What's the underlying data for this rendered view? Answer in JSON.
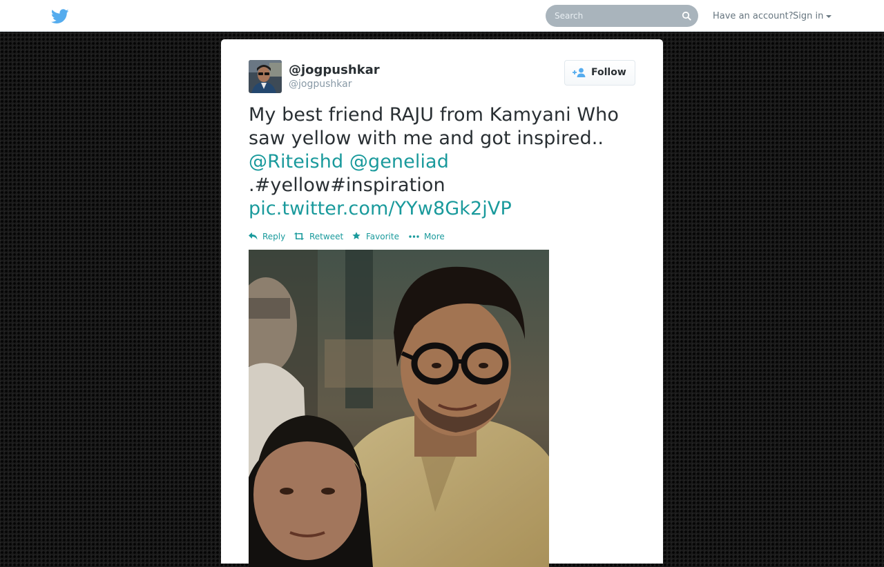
{
  "topbar": {
    "search_placeholder": "Search",
    "have_account": "Have an account?",
    "sign_in": "Sign in"
  },
  "tweet": {
    "fullname": "@jogpushkar",
    "screenname": "@jogpushkar",
    "follow_label": "Follow",
    "text_line1": "My best friend RAJU from Kamyani Who",
    "text_line2": "saw yellow with me and got inspired..",
    "mention1": "@Riteishd",
    "mention2": "@geneliad",
    "text_line4": ".#yellow#inspiration",
    "pic_link": "pic.twitter.com/YYw8Gk2jVP"
  },
  "actions": {
    "reply": "Reply",
    "retweet": "Retweet",
    "favorite": "Favorite",
    "more": "More"
  },
  "colors": {
    "link": "#1a9a9c",
    "twitter_blue": "#55acee",
    "text": "#292f33",
    "muted": "#8899a6",
    "search_bg": "#a9b4bc"
  },
  "icons": {
    "logo": "twitter-bird-icon",
    "search": "search-icon",
    "follow": "follow-person-icon",
    "reply": "reply-icon",
    "retweet": "retweet-icon",
    "favorite": "star-icon",
    "more": "more-dots-icon"
  }
}
